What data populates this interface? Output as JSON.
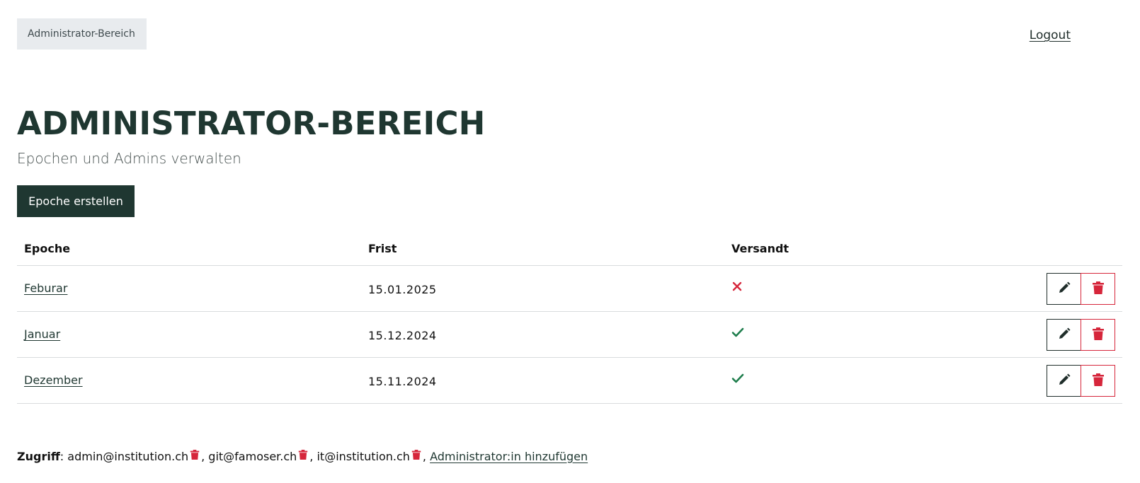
{
  "header": {
    "breadcrumb": "Administrator-Bereich",
    "logout_label": "Logout"
  },
  "page": {
    "title": "ADMINISTRATOR-BEREICH",
    "subtitle": "Epochen und Admins verwalten",
    "create_button_label": "Epoche erstellen"
  },
  "table": {
    "columns": [
      "Epoche",
      "Frist",
      "Versandt"
    ],
    "rows": [
      {
        "epoch": "Feburar",
        "deadline": "15.01.2025",
        "sent": false,
        "sent_icon": "x-icon"
      },
      {
        "epoch": "Januar",
        "deadline": "15.12.2024",
        "sent": true,
        "sent_icon": "check-icon"
      },
      {
        "epoch": "Dezember",
        "deadline": "15.11.2024",
        "sent": true,
        "sent_icon": "check-icon"
      }
    ],
    "row_actions": [
      {
        "name": "edit",
        "icon": "pencil-icon"
      },
      {
        "name": "delete",
        "icon": "trash-icon"
      }
    ]
  },
  "footer": {
    "label": "Zugriff",
    "admins": [
      "admin@institution.ch",
      "git@famoser.ch",
      "it@institution.ch"
    ],
    "add_admin_label": "Administrator:in hinzufügen"
  },
  "colors": {
    "primary": "#1f3731",
    "danger": "#d6263b",
    "success": "#1e7d4c",
    "breadcrumb_bg": "#e8ebee"
  }
}
